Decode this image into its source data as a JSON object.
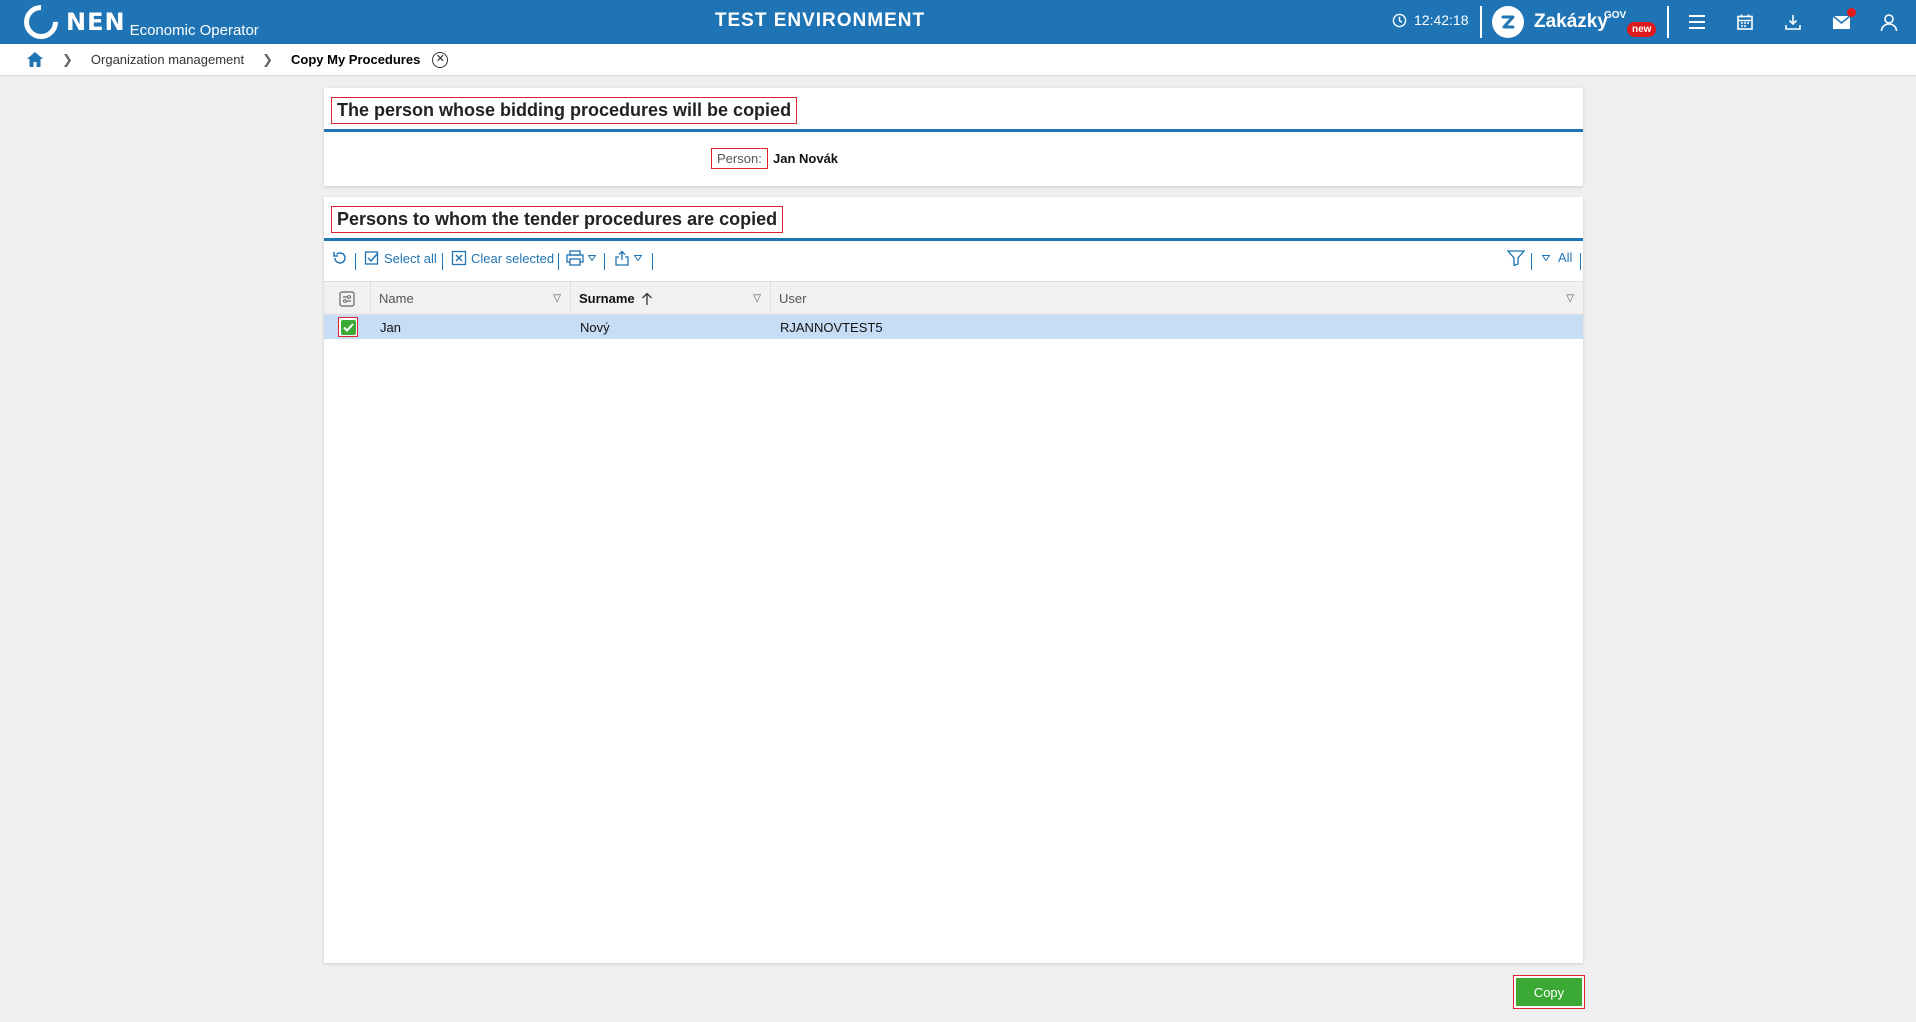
{
  "header": {
    "logo_text": "NEN",
    "logo_subtitle": "Economic Operator",
    "environment": "TEST ENVIRONMENT",
    "clock": "12:42:18",
    "zakazky": "Zakázky",
    "zakazky_gov": "GOV",
    "zakazky_badge": "new",
    "colors": {
      "brand": "#1f74b5",
      "accent_red": "#e01a1a"
    },
    "icons": [
      "clock-icon",
      "menu-icon",
      "calendar-icon",
      "download-icon",
      "mail-icon",
      "user-icon"
    ]
  },
  "breadcrumb": {
    "items": [
      "Organization management",
      "Copy My Procedures"
    ]
  },
  "section_source": {
    "title": "The person whose bidding procedures will be copied",
    "person_label": "Person:",
    "person_value": "Jan Novák"
  },
  "section_targets": {
    "title": "Persons to whom the tender procedures are copied",
    "toolbar": {
      "select_all": "Select all",
      "clear_selected": "Clear selected",
      "filter_all": "All"
    },
    "columns": [
      {
        "label": "Name"
      },
      {
        "label": "Surname",
        "sorted": "ascending"
      },
      {
        "label": "User"
      }
    ],
    "rows": [
      {
        "checked": true,
        "name": "Jan",
        "surname": "Nový",
        "user": "RJANNOVTEST5"
      }
    ]
  },
  "actions": {
    "copy_label": "Copy",
    "colors": {
      "primary": "#3aaa35"
    }
  }
}
